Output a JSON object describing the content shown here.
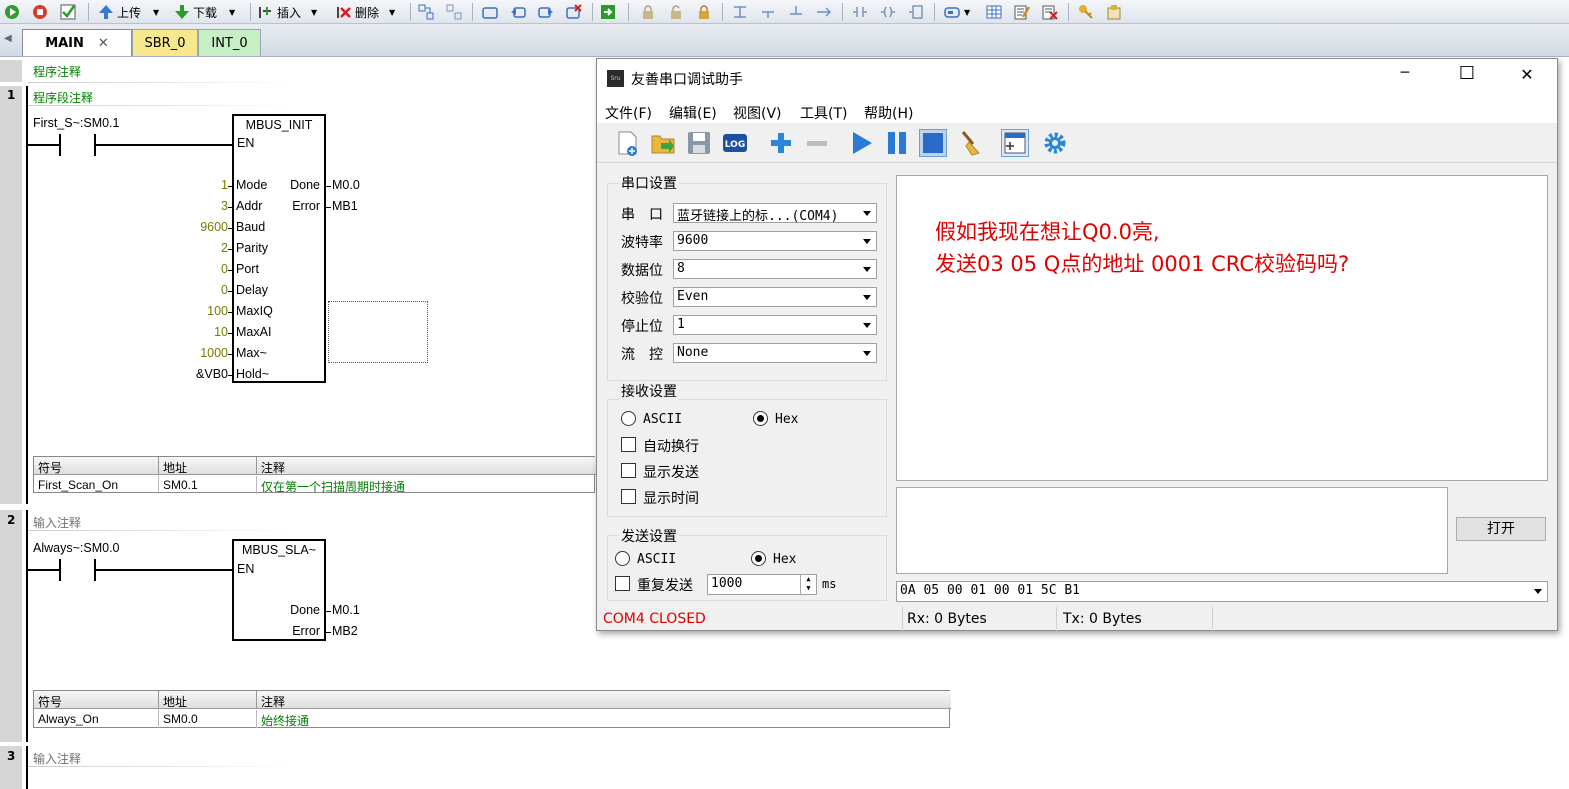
{
  "toolbar": {
    "upload_label": "上传",
    "download_label": "下载",
    "insert_label": "插入",
    "delete_label": "删除"
  },
  "tabs": [
    {
      "label": "MAIN",
      "close": "✕"
    },
    {
      "label": "SBR_0"
    },
    {
      "label": "INT_0"
    }
  ],
  "program_comment": "程序注释",
  "networks": [
    {
      "number": "1",
      "comment": "程序段注释",
      "contact_label": "First_S~:SM0.1",
      "block": {
        "name": "MBUS_INIT",
        "en": "EN",
        "inputs": [
          {
            "value": "1",
            "pin": "Mode"
          },
          {
            "value": "3",
            "pin": "Addr"
          },
          {
            "value": "9600",
            "pin": "Baud"
          },
          {
            "value": "2",
            "pin": "Parity"
          },
          {
            "value": "0",
            "pin": "Port"
          },
          {
            "value": "0",
            "pin": "Delay"
          },
          {
            "value": "100",
            "pin": "MaxIQ"
          },
          {
            "value": "10",
            "pin": "MaxAI"
          },
          {
            "value": "1000",
            "pin": "Max~"
          },
          {
            "value": "&VB0",
            "pin": "Hold~"
          }
        ],
        "outputs": [
          {
            "pin": "Done",
            "value": "M0.0"
          },
          {
            "pin": "Error",
            "value": "MB1"
          }
        ]
      },
      "symbols": {
        "headers": [
          "符号",
          "地址",
          "注释"
        ],
        "rows": [
          [
            "First_Scan_On",
            "SM0.1",
            "仅在第一个扫描周期时接通"
          ]
        ]
      }
    },
    {
      "number": "2",
      "comment": "输入注释",
      "contact_label": "Always~:SM0.0",
      "block": {
        "name": "MBUS_SLA~",
        "en": "EN",
        "outputs": [
          {
            "pin": "Done",
            "value": "M0.1"
          },
          {
            "pin": "Error",
            "value": "MB2"
          }
        ]
      },
      "symbols": {
        "headers": [
          "符号",
          "地址",
          "注释"
        ],
        "rows": [
          [
            "Always_On",
            "SM0.0",
            "始终接通"
          ]
        ]
      }
    },
    {
      "number": "3",
      "comment": "输入注释"
    }
  ],
  "serial_app": {
    "title": "友善串口调试助手",
    "app_icon": "Sru",
    "window_controls": {
      "minimize": "─",
      "maximize": "☐",
      "close": "✕"
    },
    "menu": [
      "文件(F)",
      "编辑(E)",
      "视图(V)",
      "工具(T)",
      "帮助(H)"
    ],
    "tool_icons": [
      "new-icon",
      "open-folder-icon",
      "save-icon",
      "log-icon",
      "add-icon",
      "remove-icon",
      "play-icon",
      "pause-icon",
      "stop-icon",
      "broom-icon",
      "layout-icon",
      "settings-icon"
    ],
    "log_icon_text": "LOG",
    "port_settings": {
      "title": "串口设置",
      "fields": [
        {
          "label": "串　口",
          "value": "蓝牙链接上的标...(COM4)"
        },
        {
          "label": "波特率",
          "value": "9600"
        },
        {
          "label": "数据位",
          "value": "8"
        },
        {
          "label": "校验位",
          "value": "Even"
        },
        {
          "label": "停止位",
          "value": "1"
        },
        {
          "label": "流　控",
          "value": "None"
        }
      ]
    },
    "receive_settings": {
      "title": "接收设置",
      "ascii": "ASCII",
      "hex": "Hex",
      "selected": "Hex",
      "auto_newline": "自动换行",
      "show_send": "显示发送",
      "show_time": "显示时间"
    },
    "send_settings": {
      "title": "发送设置",
      "ascii": "ASCII",
      "hex": "Hex",
      "selected": "Hex",
      "repeat_send": "重复发送",
      "interval_value": "1000",
      "interval_unit": "ms"
    },
    "receive_text": [
      "假如我现在想让Q0.0亮,",
      "发送03 05 Q点的地址 0001 CRC校验码吗?"
    ],
    "open_button": "打开",
    "send_history_value": "0A 05 00 01 00 01 5C B1",
    "status": {
      "port": "COM4 CLOSED",
      "rx": "Rx: 0 Bytes",
      "tx": "Tx: 0 Bytes"
    },
    "colors": {
      "annotation": "#e00000",
      "status_closed": "#e00000"
    }
  }
}
